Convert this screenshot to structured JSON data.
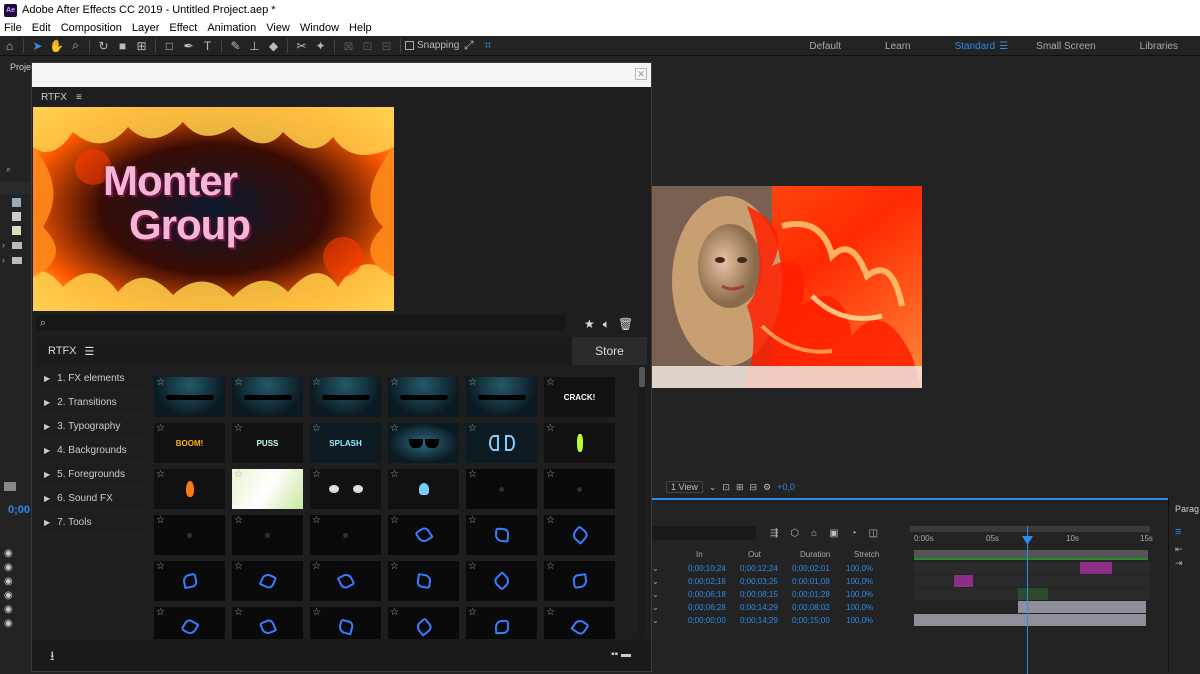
{
  "window": {
    "title": "Adobe After Effects CC 2019 - Untitled Project.aep *",
    "app_badge": "Ae"
  },
  "menu": [
    "File",
    "Edit",
    "Composition",
    "Layer",
    "Effect",
    "Animation",
    "View",
    "Window",
    "Help"
  ],
  "toolbar": {
    "snapping_label": "Snapping",
    "workspaces": [
      {
        "label": "Default",
        "active": false
      },
      {
        "label": "Learn",
        "active": false
      },
      {
        "label": "Standard",
        "active": true
      },
      {
        "label": "Small Screen",
        "active": false
      },
      {
        "label": "Libraries",
        "active": false
      }
    ]
  },
  "project_panel": {
    "tab_label": "Proje"
  },
  "rtfx": {
    "panel_tab": "RTFX",
    "preview": {
      "line1": "Monter",
      "line2": "Group"
    },
    "search_placeholder": "",
    "library_label": "RTFX",
    "store_label": "Store",
    "categories": [
      "1. FX elements",
      "2. Transitions",
      "3. Typography",
      "4. Backgrounds",
      "5. Foregrounds",
      "6. Sound FX",
      "7. Tools"
    ],
    "grid_rows": [
      [
        {
          "kind": "smoke"
        },
        {
          "kind": "smoke"
        },
        {
          "kind": "smoke"
        },
        {
          "kind": "smoke"
        },
        {
          "kind": "smoke"
        },
        {
          "kind": "crack",
          "text": "CRACK!"
        }
      ],
      [
        {
          "kind": "boom",
          "text": "BOOM!"
        },
        {
          "kind": "cloud",
          "text": "PUSS"
        },
        {
          "kind": "splash",
          "text": "SPLASH"
        },
        {
          "kind": "glasses"
        },
        {
          "kind": "wings"
        },
        {
          "kind": "lime"
        }
      ],
      [
        {
          "kind": "flame"
        },
        {
          "kind": "flash"
        },
        {
          "kind": "puffs"
        },
        {
          "kind": "bulb"
        },
        {
          "kind": "dark"
        },
        {
          "kind": "dark"
        }
      ],
      [
        {
          "kind": "dark"
        },
        {
          "kind": "dark"
        },
        {
          "kind": "dark"
        },
        {
          "kind": "elec"
        },
        {
          "kind": "elec"
        },
        {
          "kind": "elec"
        }
      ],
      [
        {
          "kind": "elec"
        },
        {
          "kind": "elec"
        },
        {
          "kind": "elec"
        },
        {
          "kind": "elec"
        },
        {
          "kind": "elec"
        },
        {
          "kind": "elec"
        }
      ],
      [
        {
          "kind": "elec"
        },
        {
          "kind": "elec"
        },
        {
          "kind": "elec"
        },
        {
          "kind": "elec"
        },
        {
          "kind": "elec"
        },
        {
          "kind": "elec"
        }
      ]
    ]
  },
  "viewer": {
    "view_select": "1 View",
    "exposure": "+0,0"
  },
  "timeline": {
    "time": "0;00",
    "columns": [
      "In",
      "Out",
      "Duration",
      "Stretch"
    ],
    "rows": [
      {
        "in": "0;00;10;24",
        "out": "0;00;12;24",
        "duration": "0;00;02;01",
        "stretch": "100,0%"
      },
      {
        "in": "0;00;02;18",
        "out": "0;00;03;25",
        "duration": "0;00;01;08",
        "stretch": "100,0%"
      },
      {
        "in": "0;00;06;18",
        "out": "0;00;08;15",
        "duration": "0;00;01;28",
        "stretch": "100,0%"
      },
      {
        "in": "0;00;06;28",
        "out": "0;00;14;29",
        "duration": "0;00;08;02",
        "stretch": "100,0%"
      },
      {
        "in": "0;00;00;00",
        "out": "0;00;14;29",
        "duration": "0;00;15;00",
        "stretch": "100,0%"
      }
    ],
    "ruler_labels": [
      "0:00s",
      "05s",
      "10s",
      "15s"
    ]
  },
  "paragraph_panel": {
    "tab_label": "Parag"
  },
  "colors": {
    "accent": "#2d8ceb",
    "fire": "#ff3b00",
    "purple_clip": "#8a2e86",
    "gray_clip": "#8f8f99",
    "green_clip": "#2d4a2d"
  }
}
